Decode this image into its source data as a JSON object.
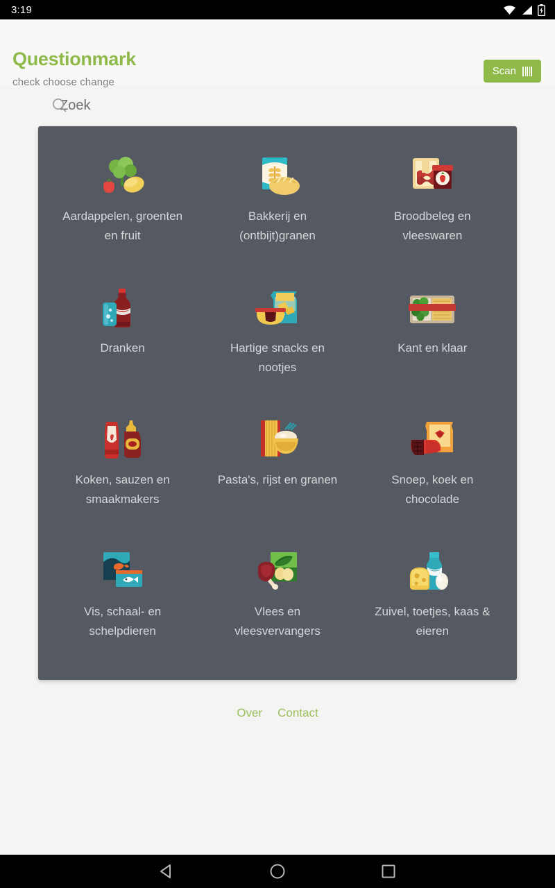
{
  "status_bar": {
    "time": "3:19",
    "icons": [
      "wifi-icon",
      "signal-icon",
      "battery-charging-icon"
    ]
  },
  "header": {
    "brand_title": "Questionmark",
    "brand_tagline": "check choose change",
    "scan_label": "Scan",
    "scan_icon": "barcode-icon",
    "brand_color": "#8fba4a"
  },
  "search": {
    "placeholder": "Zoek",
    "value": "",
    "icon": "search-icon"
  },
  "categories": {
    "panel_color": "#555962",
    "items": [
      {
        "label": "Aardappelen, groenten en fruit",
        "icon": "vegetables-fruit-icon"
      },
      {
        "label": "Bakkerij en (ontbijt)granen",
        "icon": "bread-cereal-icon"
      },
      {
        "label": "Broodbeleg en vleeswaren",
        "icon": "sandwich-spread-icon"
      },
      {
        "label": "Dranken",
        "icon": "beverages-icon"
      },
      {
        "label": "Hartige snacks en nootjes",
        "icon": "savory-snacks-icon"
      },
      {
        "label": "Kant en klaar",
        "icon": "ready-meal-icon"
      },
      {
        "label": "Koken, sauzen en smaakmakers",
        "icon": "sauces-icon"
      },
      {
        "label": "Pasta's, rijst en granen",
        "icon": "pasta-rice-icon"
      },
      {
        "label": "Snoep, koek en chocolade",
        "icon": "candy-chocolate-icon"
      },
      {
        "label": "Vis, schaal- en schelpdieren",
        "icon": "fish-seafood-icon"
      },
      {
        "label": "Vlees en vleesvervangers",
        "icon": "meat-substitutes-icon"
      },
      {
        "label": "Zuivel, toetjes, kaas & eieren",
        "icon": "dairy-eggs-icon"
      }
    ]
  },
  "footer": {
    "links": [
      {
        "label": "Over"
      },
      {
        "label": "Contact"
      }
    ],
    "link_color": "#9bbf5c"
  },
  "nav_bar": {
    "back_label": "back-button",
    "home_label": "home-button",
    "recents_label": "recents-button"
  }
}
